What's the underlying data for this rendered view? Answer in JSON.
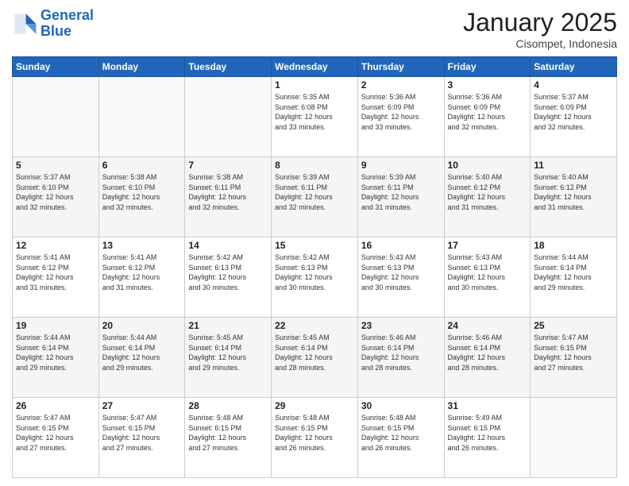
{
  "header": {
    "logo_line1": "General",
    "logo_line2": "Blue",
    "month": "January 2025",
    "location": "Cisompet, Indonesia"
  },
  "weekdays": [
    "Sunday",
    "Monday",
    "Tuesday",
    "Wednesday",
    "Thursday",
    "Friday",
    "Saturday"
  ],
  "weeks": [
    [
      {
        "day": "",
        "info": ""
      },
      {
        "day": "",
        "info": ""
      },
      {
        "day": "",
        "info": ""
      },
      {
        "day": "1",
        "info": "Sunrise: 5:35 AM\nSunset: 6:08 PM\nDaylight: 12 hours\nand 33 minutes."
      },
      {
        "day": "2",
        "info": "Sunrise: 5:36 AM\nSunset: 6:09 PM\nDaylight: 12 hours\nand 33 minutes."
      },
      {
        "day": "3",
        "info": "Sunrise: 5:36 AM\nSunset: 6:09 PM\nDaylight: 12 hours\nand 32 minutes."
      },
      {
        "day": "4",
        "info": "Sunrise: 5:37 AM\nSunset: 6:09 PM\nDaylight: 12 hours\nand 32 minutes."
      }
    ],
    [
      {
        "day": "5",
        "info": "Sunrise: 5:37 AM\nSunset: 6:10 PM\nDaylight: 12 hours\nand 32 minutes."
      },
      {
        "day": "6",
        "info": "Sunrise: 5:38 AM\nSunset: 6:10 PM\nDaylight: 12 hours\nand 32 minutes."
      },
      {
        "day": "7",
        "info": "Sunrise: 5:38 AM\nSunset: 6:11 PM\nDaylight: 12 hours\nand 32 minutes."
      },
      {
        "day": "8",
        "info": "Sunrise: 5:39 AM\nSunset: 6:11 PM\nDaylight: 12 hours\nand 32 minutes."
      },
      {
        "day": "9",
        "info": "Sunrise: 5:39 AM\nSunset: 6:11 PM\nDaylight: 12 hours\nand 31 minutes."
      },
      {
        "day": "10",
        "info": "Sunrise: 5:40 AM\nSunset: 6:12 PM\nDaylight: 12 hours\nand 31 minutes."
      },
      {
        "day": "11",
        "info": "Sunrise: 5:40 AM\nSunset: 6:12 PM\nDaylight: 12 hours\nand 31 minutes."
      }
    ],
    [
      {
        "day": "12",
        "info": "Sunrise: 5:41 AM\nSunset: 6:12 PM\nDaylight: 12 hours\nand 31 minutes."
      },
      {
        "day": "13",
        "info": "Sunrise: 5:41 AM\nSunset: 6:12 PM\nDaylight: 12 hours\nand 31 minutes."
      },
      {
        "day": "14",
        "info": "Sunrise: 5:42 AM\nSunset: 6:13 PM\nDaylight: 12 hours\nand 30 minutes."
      },
      {
        "day": "15",
        "info": "Sunrise: 5:42 AM\nSunset: 6:13 PM\nDaylight: 12 hours\nand 30 minutes."
      },
      {
        "day": "16",
        "info": "Sunrise: 5:43 AM\nSunset: 6:13 PM\nDaylight: 12 hours\nand 30 minutes."
      },
      {
        "day": "17",
        "info": "Sunrise: 5:43 AM\nSunset: 6:13 PM\nDaylight: 12 hours\nand 30 minutes."
      },
      {
        "day": "18",
        "info": "Sunrise: 5:44 AM\nSunset: 6:14 PM\nDaylight: 12 hours\nand 29 minutes."
      }
    ],
    [
      {
        "day": "19",
        "info": "Sunrise: 5:44 AM\nSunset: 6:14 PM\nDaylight: 12 hours\nand 29 minutes."
      },
      {
        "day": "20",
        "info": "Sunrise: 5:44 AM\nSunset: 6:14 PM\nDaylight: 12 hours\nand 29 minutes."
      },
      {
        "day": "21",
        "info": "Sunrise: 5:45 AM\nSunset: 6:14 PM\nDaylight: 12 hours\nand 29 minutes."
      },
      {
        "day": "22",
        "info": "Sunrise: 5:45 AM\nSunset: 6:14 PM\nDaylight: 12 hours\nand 28 minutes."
      },
      {
        "day": "23",
        "info": "Sunrise: 5:46 AM\nSunset: 6:14 PM\nDaylight: 12 hours\nand 28 minutes."
      },
      {
        "day": "24",
        "info": "Sunrise: 5:46 AM\nSunset: 6:14 PM\nDaylight: 12 hours\nand 28 minutes."
      },
      {
        "day": "25",
        "info": "Sunrise: 5:47 AM\nSunset: 6:15 PM\nDaylight: 12 hours\nand 27 minutes."
      }
    ],
    [
      {
        "day": "26",
        "info": "Sunrise: 5:47 AM\nSunset: 6:15 PM\nDaylight: 12 hours\nand 27 minutes."
      },
      {
        "day": "27",
        "info": "Sunrise: 5:47 AM\nSunset: 6:15 PM\nDaylight: 12 hours\nand 27 minutes."
      },
      {
        "day": "28",
        "info": "Sunrise: 5:48 AM\nSunset: 6:15 PM\nDaylight: 12 hours\nand 27 minutes."
      },
      {
        "day": "29",
        "info": "Sunrise: 5:48 AM\nSunset: 6:15 PM\nDaylight: 12 hours\nand 26 minutes."
      },
      {
        "day": "30",
        "info": "Sunrise: 5:48 AM\nSunset: 6:15 PM\nDaylight: 12 hours\nand 26 minutes."
      },
      {
        "day": "31",
        "info": "Sunrise: 5:49 AM\nSunset: 6:15 PM\nDaylight: 12 hours\nand 26 minutes."
      },
      {
        "day": "",
        "info": ""
      }
    ]
  ]
}
